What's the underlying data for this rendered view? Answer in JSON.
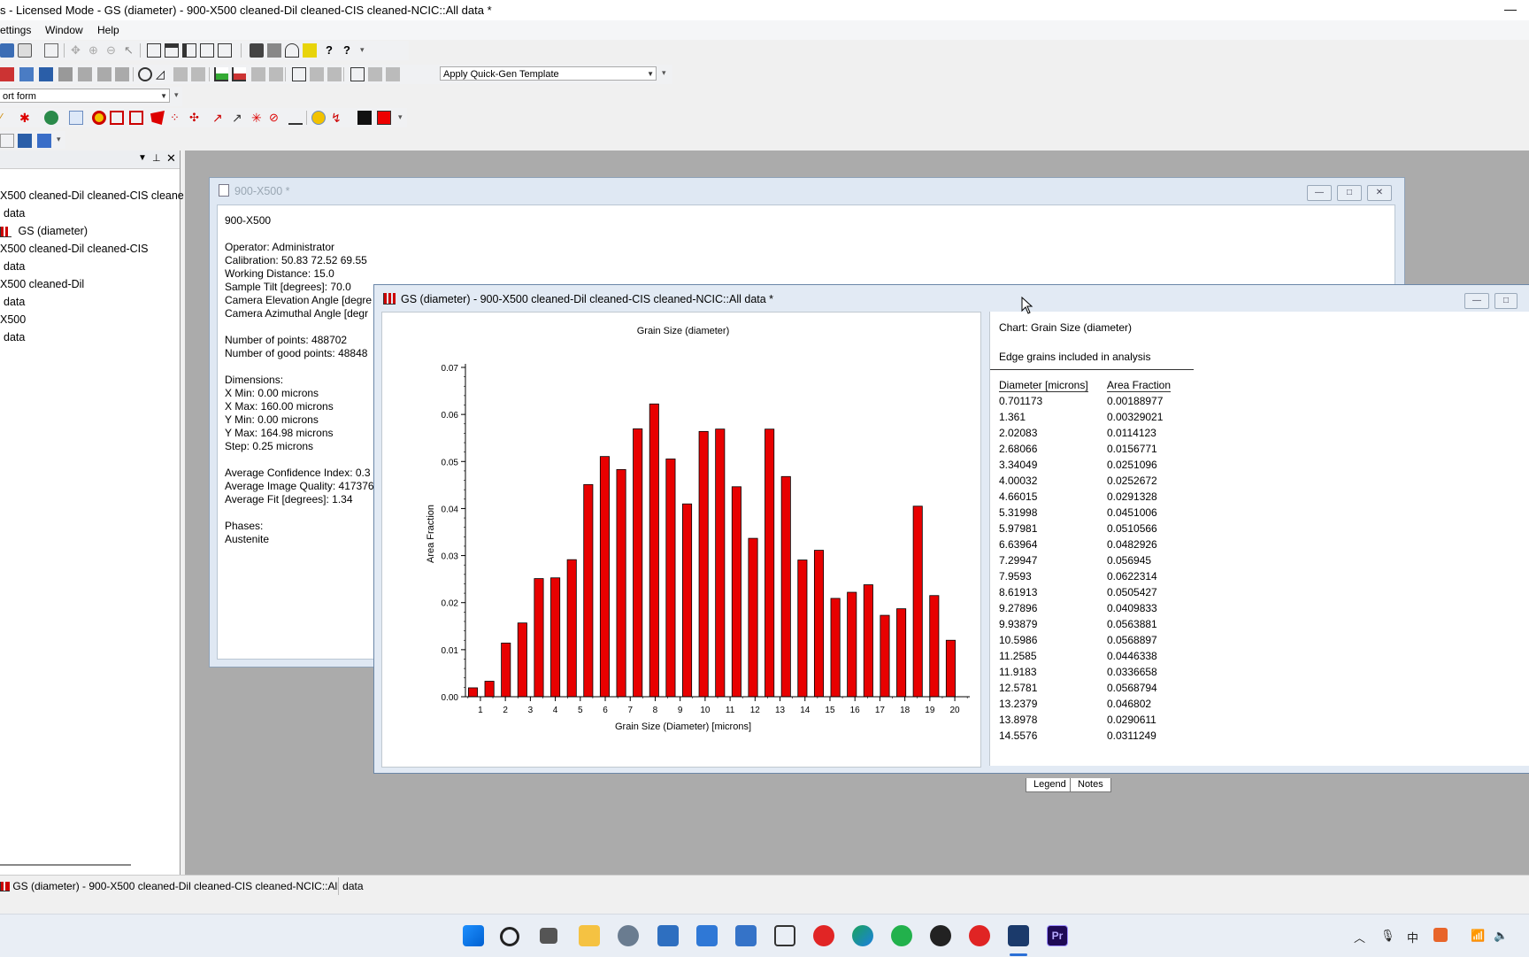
{
  "app": {
    "title": "s - Licensed Mode - GS (diameter) - 900-X500 cleaned-Dil cleaned-CIS cleaned-NCIC::All data *",
    "minimize": "—"
  },
  "menu": {
    "items": [
      "ettings",
      "Window",
      "Help"
    ]
  },
  "toolbar": {
    "template_dropdown": "Apply Quick-Gen Template",
    "report_dropdown": "ort form"
  },
  "tree": {
    "items": [
      {
        "label": "X500 cleaned-Dil cleaned-CIS cleane",
        "indent": 0
      },
      {
        "label": "data",
        "indent": 1
      },
      {
        "label": "GS (diameter)",
        "indent": 2,
        "icon": "histogram-icon"
      },
      {
        "label": "X500 cleaned-Dil cleaned-CIS",
        "indent": 0
      },
      {
        "label": "data",
        "indent": 1
      },
      {
        "label": "X500 cleaned-Dil",
        "indent": 0
      },
      {
        "label": "data",
        "indent": 1
      },
      {
        "label": "X500",
        "indent": 0
      },
      {
        "label": "data",
        "indent": 1
      }
    ]
  },
  "info_window": {
    "title": "900-X500 *",
    "lines": [
      "900-X500",
      "",
      "Operator: Administrator",
      "Calibration: 50.83  72.52  69.55",
      "Working Distance: 15.0",
      "Sample Tilt [degrees]: 70.0",
      "Camera Elevation Angle [degre",
      "Camera Azimuthal Angle [degr",
      "",
      "Number of points: 488702",
      "Number of good points: 48848",
      "",
      "Dimensions:",
      "X Min: 0.00 microns",
      "X Max: 160.00 microns",
      "Y Min: 0.00 microns",
      "Y Max: 164.98 microns",
      "Step: 0.25 microns",
      "",
      "Average Confidence Index: 0.3",
      "Average Image Quality: 417376",
      "Average Fit [degrees]: 1.34",
      "",
      "Phases:",
      "Austenite"
    ]
  },
  "chart_window": {
    "title": "GS (diameter) - 900-X500 cleaned-Dil cleaned-CIS cleaned-NCIC::All data *",
    "legend_chart_label": "Chart:  Grain Size (diameter)",
    "legend_note": "Edge grains included in analysis",
    "table": {
      "headers": [
        "Diameter [microns]",
        "Area Fraction"
      ],
      "rows": [
        [
          "0.701173",
          "0.00188977"
        ],
        [
          "1.361",
          "0.00329021"
        ],
        [
          "2.02083",
          "0.0114123"
        ],
        [
          "2.68066",
          "0.0156771"
        ],
        [
          "3.34049",
          "0.0251096"
        ],
        [
          "4.00032",
          "0.0252672"
        ],
        [
          "4.66015",
          "0.0291328"
        ],
        [
          "5.31998",
          "0.0451006"
        ],
        [
          "5.97981",
          "0.0510566"
        ],
        [
          "6.63964",
          "0.0482926"
        ],
        [
          "7.29947",
          "0.056945"
        ],
        [
          "7.9593",
          "0.0622314"
        ],
        [
          "8.61913",
          "0.0505427"
        ],
        [
          "9.27896",
          "0.0409833"
        ],
        [
          "9.93879",
          "0.0563881"
        ],
        [
          "10.5986",
          "0.0568897"
        ],
        [
          "11.2585",
          "0.0446338"
        ],
        [
          "11.9183",
          "0.0336658"
        ],
        [
          "12.5781",
          "0.0568794"
        ],
        [
          "13.2379",
          "0.046802"
        ],
        [
          "13.8978",
          "0.0290611"
        ],
        [
          "14.5576",
          "0.0311249"
        ]
      ]
    },
    "tabs": [
      "Legend",
      "Notes"
    ]
  },
  "chart_data": {
    "type": "bar",
    "title": "Grain Size (diameter)",
    "xlabel": "Grain Size (Diameter) [microns]",
    "ylabel": "Area Fraction",
    "xticks": [
      1,
      2,
      3,
      4,
      5,
      6,
      7,
      8,
      9,
      10,
      11,
      12,
      13,
      14,
      15,
      16,
      17,
      18,
      19,
      20
    ],
    "yticks": [
      "0.00",
      "0.01",
      "0.02",
      "0.03",
      "0.04",
      "0.05",
      "0.06",
      "0.07"
    ],
    "ylim": [
      0,
      0.07
    ],
    "xlim": [
      0.4,
      20.6
    ],
    "bar_color": "#e80000",
    "x": [
      0.701173,
      1.361,
      2.02083,
      2.68066,
      3.34049,
      4.00032,
      4.66015,
      5.31998,
      5.97981,
      6.63964,
      7.29947,
      7.9593,
      8.61913,
      9.27896,
      9.93879,
      10.5986,
      11.2585,
      11.9183,
      12.5781,
      13.2379,
      13.8978,
      14.5576,
      15.2174,
      15.8773,
      16.5371,
      17.1969,
      17.8568,
      18.5166,
      19.1764,
      19.8362
    ],
    "values": [
      0.00188977,
      0.00329021,
      0.0114123,
      0.0156771,
      0.0251096,
      0.0252672,
      0.0291328,
      0.0451006,
      0.0510566,
      0.0482926,
      0.056945,
      0.0622314,
      0.0505427,
      0.0409833,
      0.0563881,
      0.0568897,
      0.0446338,
      0.0336658,
      0.0568794,
      0.046802,
      0.0290611,
      0.0311249,
      0.0209,
      0.0222,
      0.0238,
      0.0173,
      0.0187,
      0.0405,
      0.0215,
      0.012
    ]
  },
  "statusbar": {
    "item": "GS (diameter) - 900-X500 cleaned-Dil cleaned-CIS cleaned-NCIC::All data"
  },
  "taskbar": {
    "icons": [
      "windows-start-icon",
      "search-icon",
      "task-view-icon",
      "file-explorer-icon",
      "settings-icon",
      "calculator-icon",
      "calendar-icon",
      "store-icon",
      "radio-icon",
      "netease-icon",
      "edge-icon",
      "wechat-icon",
      "qq-icon",
      "music-icon",
      "oim-app-icon",
      "premiere-icon"
    ],
    "tray": {
      "ime": "中"
    }
  }
}
